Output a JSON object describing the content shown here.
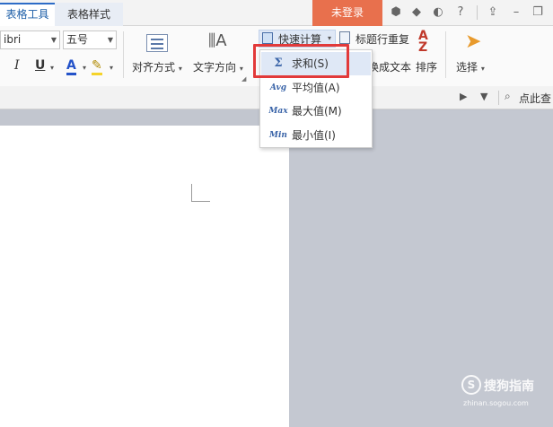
{
  "tabs": {
    "table_tools": "表格工具",
    "table_style": "表格样式"
  },
  "login": "未登录",
  "toolbar": {
    "help": "?",
    "font_name": "ibri",
    "font_size": "五号"
  },
  "ribbon": {
    "align_label": "对齐方式",
    "text_dir_label": "文字方向",
    "quick_calc_label": "快速计算",
    "header_repeat_label": "标题行重复",
    "to_text_label": "换成文本",
    "sort_label": "排序",
    "select_label": "选择",
    "search_label": "点此查"
  },
  "quick_calc_menu": [
    {
      "icon": "Σ",
      "label": "求和(S)"
    },
    {
      "icon": "Avg",
      "label": "平均值(A)"
    },
    {
      "icon": "Max",
      "label": "最大值(M)"
    },
    {
      "icon": "Min",
      "label": "最小值(I)"
    }
  ],
  "watermark": {
    "logo": "S",
    "text": "搜狗指南",
    "url": "zhinan.sogou.com"
  },
  "colors": {
    "login_bg": "#e8704d",
    "highlight": "#e23a3a",
    "accent": "#2d6cc7",
    "font_color_bar": "#2453c9",
    "highlight_bar": "#f5d32a"
  }
}
